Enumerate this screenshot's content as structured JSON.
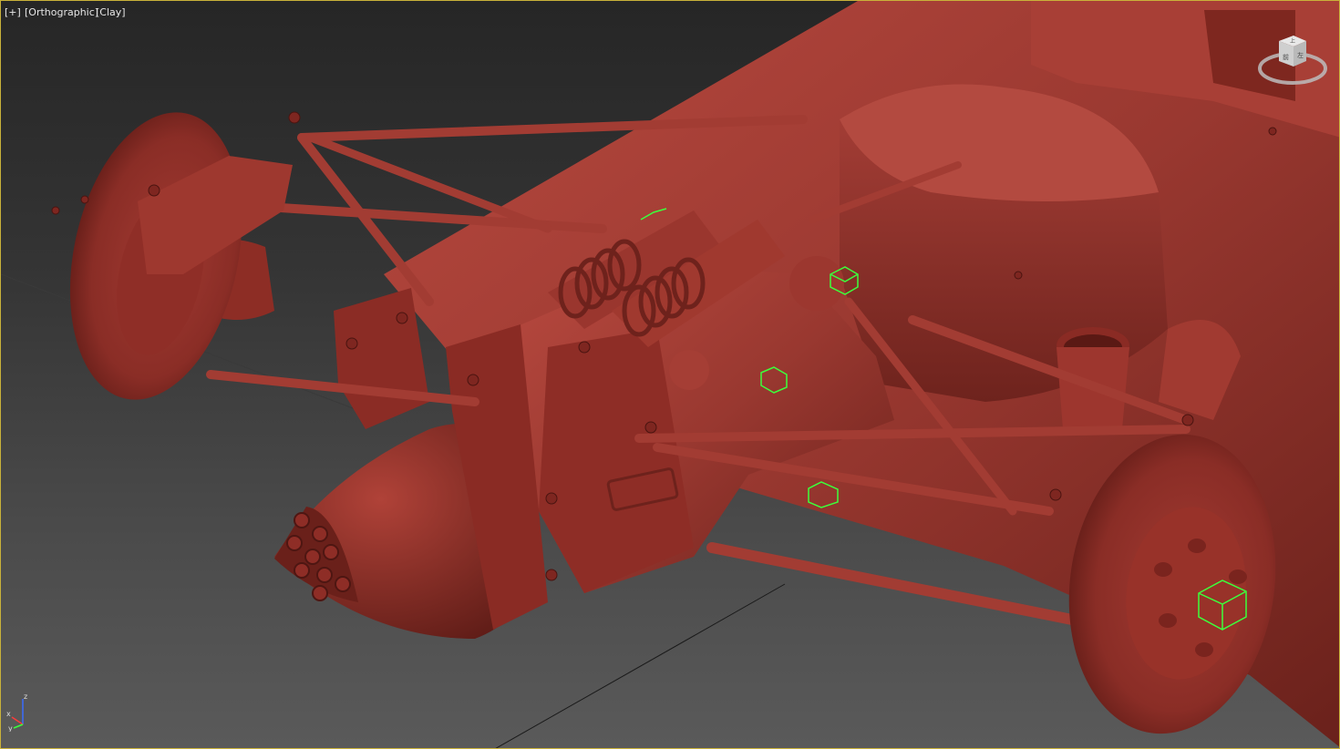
{
  "viewport": {
    "menu_plus": "[+]",
    "view_mode": "[Orthographic]",
    "shading_mode": "[Clay]"
  },
  "viewcube": {
    "top_label": "上",
    "front_label": "前",
    "side_label": "左"
  },
  "axis": {
    "z_label": "z",
    "x_label": "x",
    "y_label": "y"
  },
  "colors": {
    "clay": "#8f2f28",
    "clay_light": "#b4473e",
    "clay_dark": "#5c1c17",
    "helper": "#3cff3c",
    "border_active": "#c9b23a"
  }
}
